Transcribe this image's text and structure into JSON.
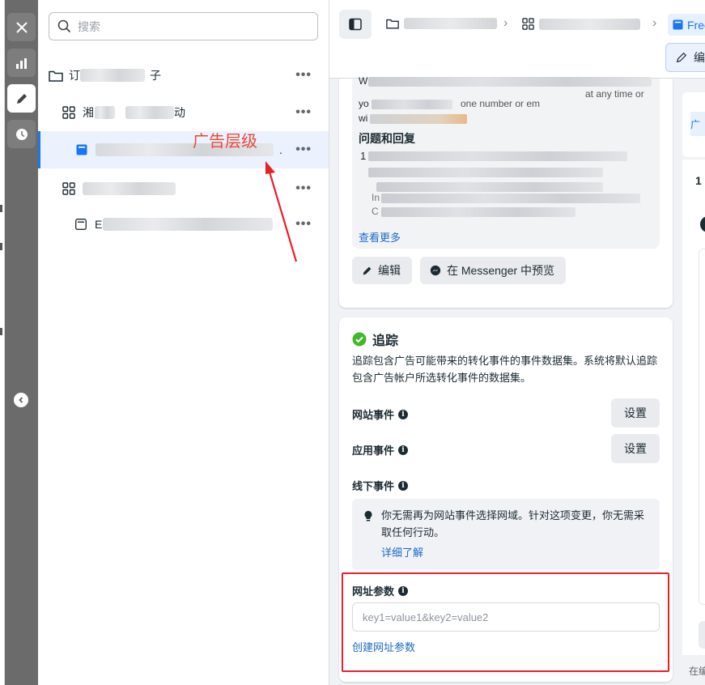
{
  "colors": {
    "accent": "#1877f2",
    "annotation": "#e8473b",
    "highlight_box": "#e8202a",
    "success": "#42b72a",
    "link": "#1b6ac9"
  },
  "rail": {
    "close_icon": "close-icon",
    "chart_icon": "bar-chart-icon",
    "edit_icon": "pencil-icon",
    "history_icon": "clock-icon",
    "collapse_icon": "chevron-left-icon"
  },
  "tree": {
    "search_placeholder": "搜索",
    "rows": [
      {
        "type": "campaign",
        "prefix": "订",
        "suffix": "子",
        "icon": "folder-icon"
      },
      {
        "type": "adset",
        "prefix": "湘",
        "suffix": "动",
        "icon": "grid-icon"
      },
      {
        "type": "ad",
        "prefix": "",
        "suffix": ".",
        "icon": "ad-icon",
        "selected": true
      },
      {
        "type": "adset",
        "prefix": "",
        "suffix": "",
        "icon": "grid-icon"
      },
      {
        "type": "ad",
        "prefix": "E",
        "suffix": "",
        "icon": "ad-icon"
      }
    ],
    "more_label": "•••"
  },
  "annotation": {
    "label": "广告层级"
  },
  "topbar": {
    "crumb_active": "Free",
    "edit_label": "编"
  },
  "preview": {
    "line1": "W",
    "line2a": "yo",
    "line2b": "one number or em",
    "line2c": "at any time or",
    "line3": "wi",
    "qa_title": "问题和回复",
    "qa_number": "1",
    "snippet1": "In",
    "snippet2": "C",
    "see_more": "查看更多",
    "edit_button": "编辑",
    "messenger_button": "在 Messenger 中预览"
  },
  "tracking": {
    "title": "追踪",
    "description": "追踪包含广告可能带来的转化事件的事件数据集。系统将默认追踪包含广告帐户所选转化事件的数据集。",
    "website_events": "网站事件",
    "app_events": "应用事件",
    "offline_events": "线下事件",
    "setup_label": "设置",
    "notice_text": "你无需再为网站事件选择网域。针对这项变更，你无需采取任何行动。",
    "notice_link": "详细了解",
    "url_params_label": "网址参数",
    "url_placeholder": "key1=value1&key2=value2",
    "url_value": "",
    "create_url_link": "创建网址参数"
  },
  "right_panel": {
    "tab_label": "广",
    "count_label": "1",
    "footer_text": "在编"
  }
}
